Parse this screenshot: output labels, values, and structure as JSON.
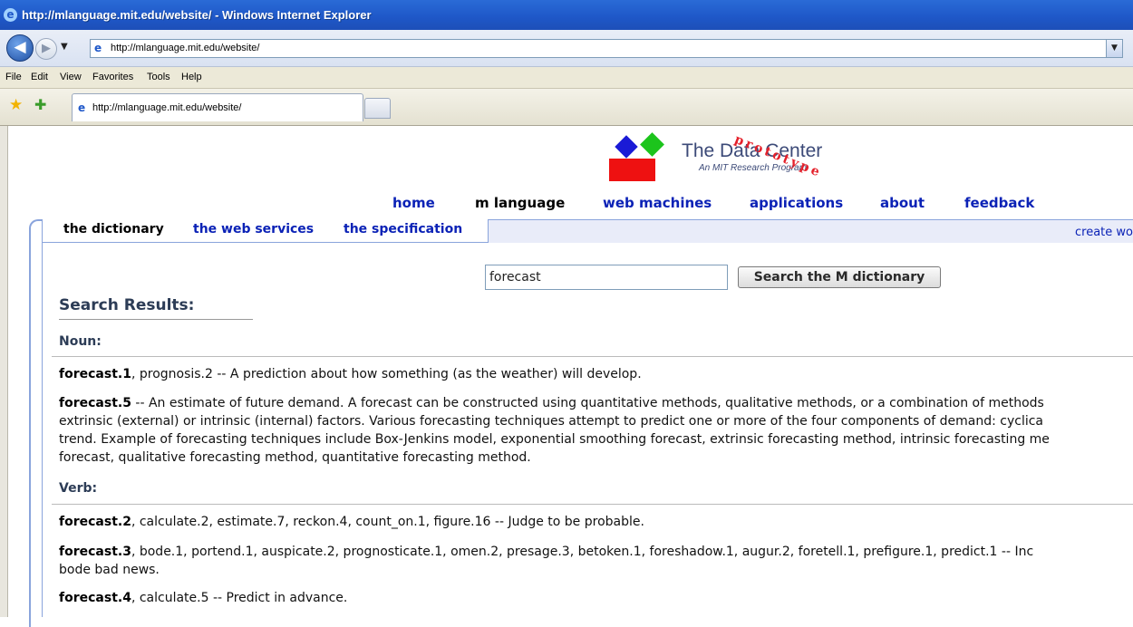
{
  "window": {
    "title": "http://mlanguage.mit.edu/website/ - Windows Internet Explorer"
  },
  "browser": {
    "address": "http://mlanguage.mit.edu/website/",
    "menu": [
      "File",
      "Edit",
      "View",
      "Favorites",
      "Tools",
      "Help"
    ],
    "tab_title": "http://mlanguage.mit.edu/website/"
  },
  "site": {
    "logo": {
      "brand": "The Data Center",
      "tagline": "An MIT Research Program",
      "stamp": "prototype"
    },
    "nav": {
      "home": "home",
      "m_language": "m language",
      "web_machines": "web machines",
      "applications": "applications",
      "about": "about",
      "feedback": "feedback"
    },
    "subnav": {
      "dictionary": "the dictionary",
      "web_services": "the web services",
      "specification": "the specification"
    },
    "create_link": "create wo"
  },
  "search": {
    "value": "forecast",
    "button": "Search the M dictionary"
  },
  "results": {
    "title": "Search Results:",
    "noun_heading": "Noun:",
    "verb_heading": "Verb:",
    "noun": [
      {
        "term": "forecast.1",
        "lines": [
          ", prognosis.2 -- A prediction about how something (as the weather) will develop."
        ]
      },
      {
        "term": "forecast.5",
        "lines": [
          " -- An estimate of future demand.  A forecast can be constructed using quantitative methods, qualitative methods, or a combination of methods",
          "extrinsic (external) or intrinsic (internal) factors.  Various forecasting techniques attempt to predict one or more of the four components of demand: cyclica",
          "trend.  Example of forecasting techniques include Box-Jenkins model, exponential smoothing forecast, extrinsic forecasting method, intrinsic forecasting me",
          "forecast, qualitative forecasting method, quantitative forecasting method."
        ]
      }
    ],
    "verb": [
      {
        "term": "forecast.2",
        "lines": [
          ", calculate.2, estimate.7, reckon.4, count_on.1, figure.16 -- Judge to be probable."
        ]
      },
      {
        "term": "forecast.3",
        "lines": [
          ", bode.1, portend.1, auspicate.2, prognosticate.1, omen.2, presage.3, betoken.1, foreshadow.1, augur.2, foretell.1, prefigure.1, predict.1 -- Inc",
          "bode bad news."
        ]
      },
      {
        "term": "forecast.4",
        "lines": [
          ", calculate.5 -- Predict in advance."
        ]
      }
    ]
  }
}
